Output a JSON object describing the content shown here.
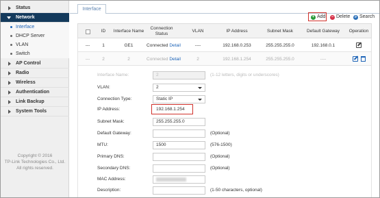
{
  "sidebar": {
    "items": [
      {
        "label": "Status"
      },
      {
        "label": "Network"
      },
      {
        "label": "AP Control"
      },
      {
        "label": "Radio"
      },
      {
        "label": "Wireless"
      },
      {
        "label": "Authentication"
      },
      {
        "label": "Link Backup"
      },
      {
        "label": "System Tools"
      }
    ],
    "subitems": [
      {
        "label": "Interface"
      },
      {
        "label": "DHCP Server"
      },
      {
        "label": "VLAN"
      },
      {
        "label": "Switch"
      }
    ],
    "copyright": [
      "Copyright © 2016",
      "TP-Link Technologies Co., Ltd.",
      "All rights reserved."
    ]
  },
  "tabs": [
    {
      "label": "Interface"
    }
  ],
  "toolbar": {
    "add_label": "Add",
    "delete_label": "Delete",
    "search_label": "Search"
  },
  "table": {
    "headers": [
      "ID",
      "Interface Name",
      "Connection Status",
      "VLAN",
      "IP Address",
      "Subnet Mask",
      "Default Gateway",
      "Operation"
    ],
    "rows": [
      {
        "dash": "---",
        "id": "1",
        "name": "GE1",
        "status": "Connected",
        "detail": "Detail",
        "vlan": "----",
        "ip": "192.168.0.253",
        "mask": "255.255.255.0",
        "gateway": "192.168.0.1"
      },
      {
        "dash": "---",
        "id": "2",
        "name": "2",
        "status": "Connected",
        "detail": "Detail",
        "vlan": "2",
        "ip": "192.168.1.254",
        "mask": "255.255.255.0",
        "gateway": "----"
      }
    ]
  },
  "form": {
    "interface_name": {
      "label": "Interface Name:",
      "value": "2",
      "hint": "(1-12 letters, digits or underscores)"
    },
    "vlan": {
      "label": "VLAN:",
      "value": "2"
    },
    "connection_type": {
      "label": "Connection Type:",
      "value": "Static IP"
    },
    "ip_address": {
      "label": "IP Address:",
      "value": "192.168.1.254"
    },
    "subnet_mask": {
      "label": "Subnet Mask:",
      "value": "255.255.255.0"
    },
    "default_gateway": {
      "label": "Default Gateway:",
      "value": "",
      "hint": "(Optional)"
    },
    "mtu": {
      "label": "MTU:",
      "value": "1500",
      "hint": "(576-1500)"
    },
    "primary_dns": {
      "label": "Primary DNS:",
      "value": "",
      "hint": "(Optional)"
    },
    "secondary_dns": {
      "label": "Secondary DNS:",
      "value": "",
      "hint": "(Optional)"
    },
    "mac_address": {
      "label": "MAC Address:",
      "value": ""
    },
    "description": {
      "label": "Description:",
      "value": "",
      "hint": "(1-50 characters, optional)"
    }
  },
  "colors": {
    "nav_active": "#143a5c",
    "link": "#1c63b7",
    "highlight": "#d0302a",
    "add_icon": "#2b9a3a",
    "delete_icon": "#d6334a",
    "search_icon": "#2a6fb8"
  }
}
